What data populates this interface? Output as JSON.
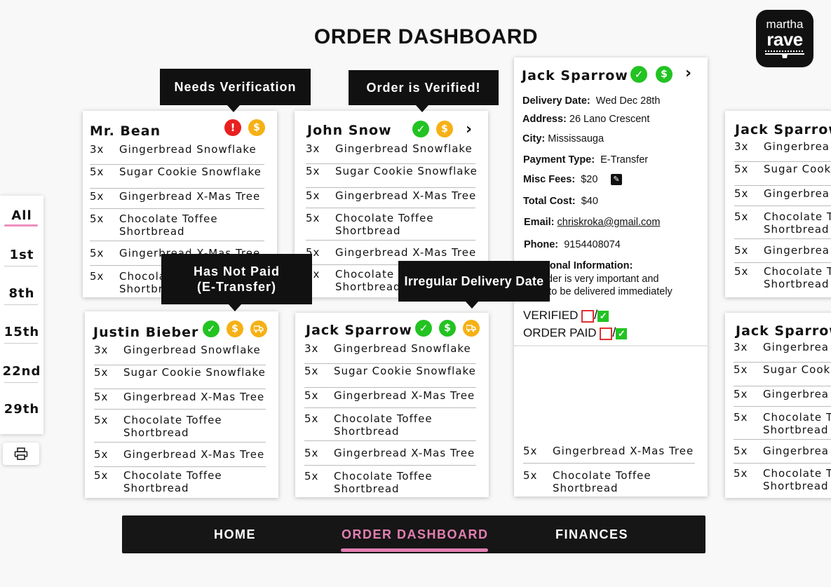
{
  "page_title": "ORDER DASHBOARD",
  "logo": {
    "line1": "martha",
    "line2": "rave"
  },
  "sidebar": {
    "items": [
      "All",
      "1st",
      "8th",
      "15th",
      "22nd",
      "29th"
    ],
    "selected": "All"
  },
  "tooltips": {
    "needs_verification": "Needs Verification",
    "order_verified": "Order is Verified!",
    "has_not_paid_l1": "Has Not Paid",
    "has_not_paid_l2": "(E-Transfer)",
    "irregular_delivery": "Irregular Delivery Date"
  },
  "cards": {
    "mr_bean": {
      "name": "Mr. Bean",
      "rows": [
        {
          "q": "3x",
          "item": "Gingerbread Snowflake"
        },
        {
          "q": "5x",
          "item": "Sugar Cookie Snowflake"
        },
        {
          "q": "5x",
          "item": "Gingerbread X-Mas Tree"
        },
        {
          "q": "5x",
          "item": "Chocolate Toffee",
          "item2": "Shortbread"
        },
        {
          "q": "5x",
          "item": "Gingerbread X-Mas Tree"
        },
        {
          "q": "5x",
          "item": "Chocolate Toffee",
          "item2": "Shortbread"
        }
      ]
    },
    "john_snow": {
      "name": "John Snow",
      "rows": [
        {
          "q": "3x",
          "item": "Gingerbread Snowflake"
        },
        {
          "q": "5x",
          "item": "Sugar Cookie Snowflake"
        },
        {
          "q": "5x",
          "item": "Gingerbread X-Mas Tree"
        },
        {
          "q": "5x",
          "item": "Chocolate Toffee",
          "item2": "Shortbread"
        },
        {
          "q": "5x",
          "item": "Gingerbread X-Mas Tree"
        },
        {
          "q": "5x",
          "item": "Chocolate Toffee",
          "item2": "Shortbread"
        }
      ]
    },
    "justin_bieber": {
      "name": "Justin Bieber",
      "rows": [
        {
          "q": "3x",
          "item": "Gingerbread Snowflake"
        },
        {
          "q": "5x",
          "item": "Sugar Cookie Snowflake"
        },
        {
          "q": "5x",
          "item": "Gingerbread X-Mas Tree"
        },
        {
          "q": "5x",
          "item": "Chocolate Toffee",
          "item2": "Shortbread"
        },
        {
          "q": "5x",
          "item": "Gingerbread X-Mas Tree"
        },
        {
          "q": "5x",
          "item": "Chocolate Toffee",
          "item2": "Shortbread"
        }
      ]
    },
    "jack_sparrow_mid": {
      "name": "Jack Sparrow",
      "rows": [
        {
          "q": "3x",
          "item": "Gingerbread Snowflake"
        },
        {
          "q": "5x",
          "item": "Sugar Cookie Snowflake"
        },
        {
          "q": "5x",
          "item": "Gingerbread X-Mas Tree"
        },
        {
          "q": "5x",
          "item": "Chocolate Toffee",
          "item2": "Shortbread"
        },
        {
          "q": "5x",
          "item": "Gingerbread X-Mas Tree"
        },
        {
          "q": "5x",
          "item": "Chocolate Toffee",
          "item2": "Shortbread"
        }
      ]
    },
    "jack_sparrow_detail": {
      "name": "Jack Sparrow",
      "delivery_label": "Delivery Date:",
      "delivery_value": "Wed Dec 28th",
      "address_label": "Address:",
      "address_value": "26 Lano Crescent",
      "city_label": "City:",
      "city_value": "Mississauga",
      "payment_label": "Payment Type:",
      "payment_value": "E-Transfer",
      "misc_label": "Misc Fees:",
      "misc_value": "$20",
      "total_label": "Total Cost:",
      "total_value": "$40",
      "email_label": "Email:",
      "email_value": "chriskroka@gmail.com",
      "phone_label": "Phone:",
      "phone_value": "9154408074",
      "addl_label": "itional Information:",
      "addl_l1": "order is very important and",
      "addl_l2": "s to be delivered immediately",
      "verified_label": "VERIFIED",
      "paid_label": "ORDER PAID",
      "rows": [
        {
          "q": "5x",
          "item": "Gingerbread X-Mas Tree"
        },
        {
          "q": "5x",
          "item": "Chocolate Toffee",
          "item2": "Shortbread"
        }
      ]
    },
    "jack_sparrow_r1": {
      "name": "Jack Sparrow",
      "rows": [
        {
          "q": "3x",
          "item": "Gingerbrea"
        },
        {
          "q": "5x",
          "item": "Sugar Cook"
        },
        {
          "q": "5x",
          "item": "Gingerbrea"
        },
        {
          "q": "5x",
          "item": "Chocolate T",
          "item2": "Shortbread"
        },
        {
          "q": "5x",
          "item": "Gingerbrea"
        },
        {
          "q": "5x",
          "item": "Chocolate T",
          "item2": "Shortbread"
        }
      ]
    },
    "jack_sparrow_r2": {
      "name": "Jack Sparrow",
      "rows": [
        {
          "q": "3x",
          "item": "Gingerbrea"
        },
        {
          "q": "5x",
          "item": "Sugar Cook"
        },
        {
          "q": "5x",
          "item": "Gingerbrea"
        },
        {
          "q": "5x",
          "item": "Chocolate T",
          "item2": "Shortbread"
        },
        {
          "q": "5x",
          "item": "Gingerbrea"
        },
        {
          "q": "5x",
          "item": "Chocolate T",
          "item2": "Shortbread"
        }
      ]
    }
  },
  "nav": {
    "home": "HOME",
    "dashboard": "ORDER DASHBOARD",
    "finances": "FINANCES",
    "active": "ORDER DASHBOARD"
  },
  "colors": {
    "verified_green": "#22c322",
    "alert_red": "#e82020",
    "payment_orange": "#f5b115",
    "active_pink": "#e37fb1",
    "nav_bg": "#161616"
  },
  "icons": [
    "exclamation-icon",
    "dollar-icon",
    "check-icon",
    "truck-icon",
    "chevron-right-icon",
    "edit-icon",
    "printer-icon"
  ]
}
